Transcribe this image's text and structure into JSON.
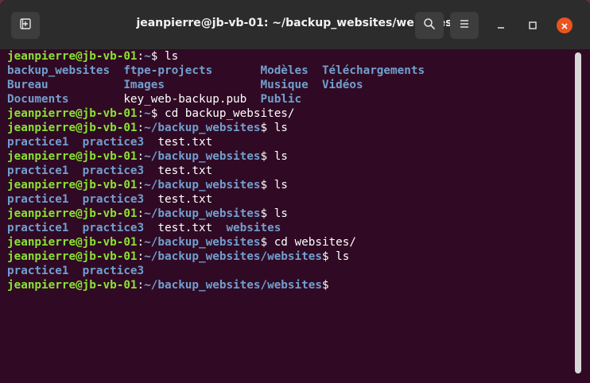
{
  "window": {
    "title": "jeanpierre@jb-vb-01: ~/backup_websites/websites"
  },
  "terminal": {
    "lines": [
      [
        {
          "t": "jeanpierre@jb-vb-01",
          "c": "user"
        },
        {
          "t": ":",
          "c": "plain"
        },
        {
          "t": "~",
          "c": "path"
        },
        {
          "t": "$ ls",
          "c": "plain"
        }
      ],
      [
        {
          "t": "backup_websites  ftpe-projects       Modèles  Téléchargements",
          "c": "dir"
        }
      ],
      [
        {
          "t": "Bureau           Images              Musique  Vidéos",
          "c": "dir"
        }
      ],
      [
        {
          "t": "Documents        ",
          "c": "dir"
        },
        {
          "t": "key_web-backup.pub  ",
          "c": "plain"
        },
        {
          "t": "Public",
          "c": "dir"
        }
      ],
      [
        {
          "t": "jeanpierre@jb-vb-01",
          "c": "user"
        },
        {
          "t": ":",
          "c": "plain"
        },
        {
          "t": "~",
          "c": "path"
        },
        {
          "t": "$ cd backup_websites/",
          "c": "plain"
        }
      ],
      [
        {
          "t": "jeanpierre@jb-vb-01",
          "c": "user"
        },
        {
          "t": ":",
          "c": "plain"
        },
        {
          "t": "~/backup_websites",
          "c": "path"
        },
        {
          "t": "$ ls",
          "c": "plain"
        }
      ],
      [
        {
          "t": "practice1  practice3",
          "c": "dir"
        },
        {
          "t": "  test.txt",
          "c": "plain"
        }
      ],
      [
        {
          "t": "jeanpierre@jb-vb-01",
          "c": "user"
        },
        {
          "t": ":",
          "c": "plain"
        },
        {
          "t": "~/backup_websites",
          "c": "path"
        },
        {
          "t": "$ ls",
          "c": "plain"
        }
      ],
      [
        {
          "t": "practice1  practice3",
          "c": "dir"
        },
        {
          "t": "  test.txt",
          "c": "plain"
        }
      ],
      [
        {
          "t": "jeanpierre@jb-vb-01",
          "c": "user"
        },
        {
          "t": ":",
          "c": "plain"
        },
        {
          "t": "~/backup_websites",
          "c": "path"
        },
        {
          "t": "$ ls",
          "c": "plain"
        }
      ],
      [
        {
          "t": "practice1  practice3",
          "c": "dir"
        },
        {
          "t": "  test.txt",
          "c": "plain"
        }
      ],
      [
        {
          "t": "jeanpierre@jb-vb-01",
          "c": "user"
        },
        {
          "t": ":",
          "c": "plain"
        },
        {
          "t": "~/backup_websites",
          "c": "path"
        },
        {
          "t": "$ ls",
          "c": "plain"
        }
      ],
      [
        {
          "t": "practice1  practice3",
          "c": "dir"
        },
        {
          "t": "  test.txt  ",
          "c": "plain"
        },
        {
          "t": "websites",
          "c": "dir"
        }
      ],
      [
        {
          "t": "jeanpierre@jb-vb-01",
          "c": "user"
        },
        {
          "t": ":",
          "c": "plain"
        },
        {
          "t": "~/backup_websites",
          "c": "path"
        },
        {
          "t": "$ cd websites/",
          "c": "plain"
        }
      ],
      [
        {
          "t": "jeanpierre@jb-vb-01",
          "c": "user"
        },
        {
          "t": ":",
          "c": "plain"
        },
        {
          "t": "~/backup_websites/websites",
          "c": "path"
        },
        {
          "t": "$ ls",
          "c": "plain"
        }
      ],
      [
        {
          "t": "practice1  practice3",
          "c": "dir"
        }
      ],
      [
        {
          "t": "jeanpierre@jb-vb-01",
          "c": "user"
        },
        {
          "t": ":",
          "c": "plain"
        },
        {
          "t": "~/backup_websites/websites",
          "c": "path"
        },
        {
          "t": "$",
          "c": "plain"
        }
      ]
    ]
  },
  "icons": {
    "new_tab": "new-tab-icon",
    "search": "search-icon",
    "menu": "hamburger-menu-icon",
    "minimize": "minimize-icon",
    "maximize": "maximize-icon",
    "close": "close-icon"
  },
  "colors": {
    "terminal_bg": "#300a24",
    "prompt_user": "#8ae234",
    "prompt_path": "#729fcf",
    "close_button": "#e95420"
  }
}
